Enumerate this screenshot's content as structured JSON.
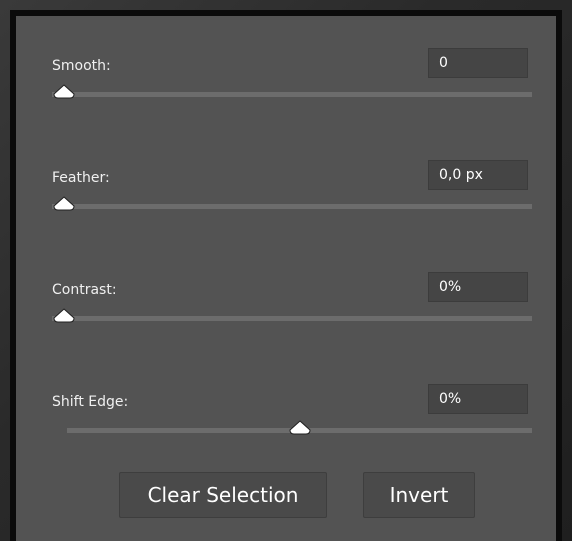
{
  "sliders": [
    {
      "label": "Smooth:",
      "value": "0",
      "position": 0.0
    },
    {
      "label": "Feather:",
      "value": "0,0 px",
      "position": 0.0
    },
    {
      "label": "Contrast:",
      "value": "0%",
      "position": 0.0
    },
    {
      "label": "Shift Edge:",
      "value": "0%",
      "position": 0.5
    }
  ],
  "buttons": {
    "clear_selection": "Clear Selection",
    "invert": "Invert"
  },
  "colors": {
    "panel": "#535353",
    "track": "#6c6c6c",
    "value_box": "#454545",
    "thumb": "#ffffff"
  }
}
